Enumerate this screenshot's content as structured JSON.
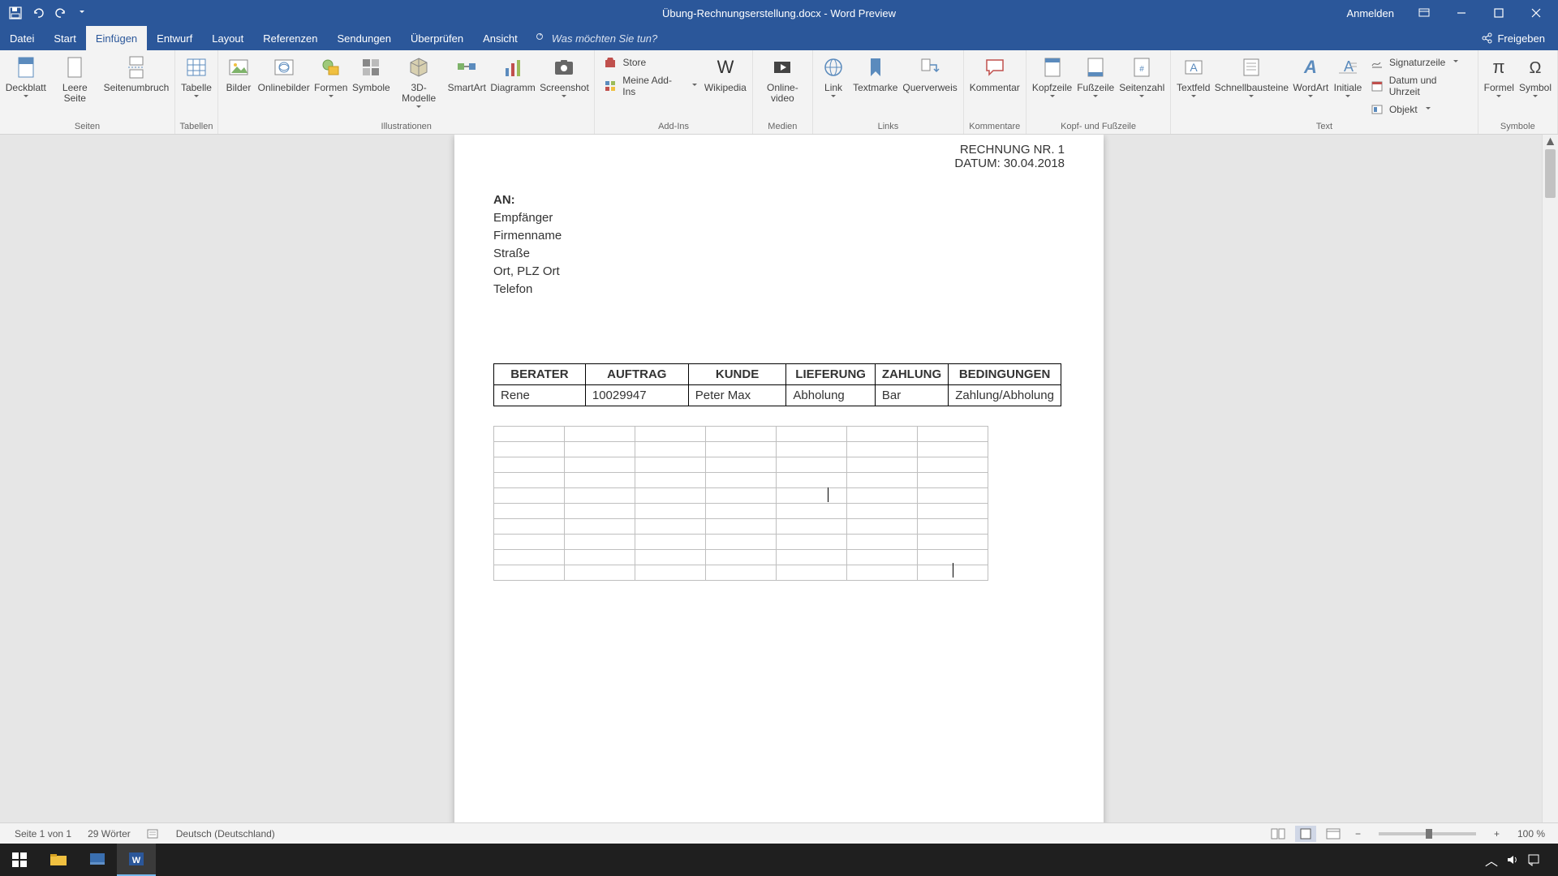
{
  "titlebar": {
    "document_title": "Übung-Rechnungserstellung.docx - Word Preview",
    "sign_in": "Anmelden"
  },
  "tabs": {
    "file": "Datei",
    "home": "Start",
    "insert": "Einfügen",
    "design": "Entwurf",
    "layout": "Layout",
    "references": "Referenzen",
    "mailings": "Sendungen",
    "review": "Überprüfen",
    "view": "Ansicht",
    "tell_me": "Was möchten Sie tun?",
    "share": "Freigeben"
  },
  "ribbon": {
    "pages": {
      "label": "Seiten",
      "cover": "Deckblatt",
      "blank": "Leere Seite",
      "break": "Seitenumbruch"
    },
    "tables": {
      "label": "Tabellen",
      "table": "Tabelle"
    },
    "illustrations": {
      "label": "Illustrationen",
      "pictures": "Bilder",
      "online": "Onlinebilder",
      "shapes": "Formen",
      "icons": "Symbole",
      "models3d": "3D-Modelle",
      "smartart": "SmartArt",
      "chart": "Diagramm",
      "screenshot": "Screenshot"
    },
    "addins": {
      "label": "Add-Ins",
      "store": "Store",
      "my": "Meine Add-Ins",
      "wikipedia": "Wikipedia"
    },
    "media": {
      "label": "Medien",
      "online_video": "Online-video"
    },
    "links": {
      "label": "Links",
      "link": "Link",
      "bookmark": "Textmarke",
      "crossref": "Querverweis"
    },
    "comments": {
      "label": "Kommentare",
      "comment": "Kommentar"
    },
    "headerfooter": {
      "label": "Kopf- und Fußzeile",
      "header": "Kopfzeile",
      "footer": "Fußzeile",
      "page_num": "Seitenzahl"
    },
    "text": {
      "label": "Text",
      "textbox": "Textfeld",
      "quickparts": "Schnellbausteine",
      "wordart": "WordArt",
      "dropcap": "Initiale",
      "signature": "Signaturzeile",
      "datetime": "Datum und Uhrzeit",
      "object": "Objekt"
    },
    "symbols": {
      "label": "Symbole",
      "equation": "Formel",
      "symbol": "Symbol"
    }
  },
  "document": {
    "invoice_nr": "RECHNUNG NR. 1",
    "date": "DATUM: 30.04.2018",
    "to_label": "AN:",
    "recipient": "Empfänger",
    "company": "Firmenname",
    "street": "Straße",
    "city": "Ort, PLZ Ort",
    "phone": "Telefon",
    "table_headers": [
      "BERATER",
      "AUFTRAG",
      "KUNDE",
      "LIEFERUNG",
      "ZAHLUNG",
      "BEDINGUNGEN"
    ],
    "table_row": [
      "Rene",
      "10029947",
      "Peter Max",
      "Abholung",
      "Bar",
      "Zahlung/Abholung"
    ]
  },
  "statusbar": {
    "page": "Seite 1 von 1",
    "words": "29 Wörter",
    "lang": "Deutsch (Deutschland)",
    "zoom": "100 %"
  }
}
